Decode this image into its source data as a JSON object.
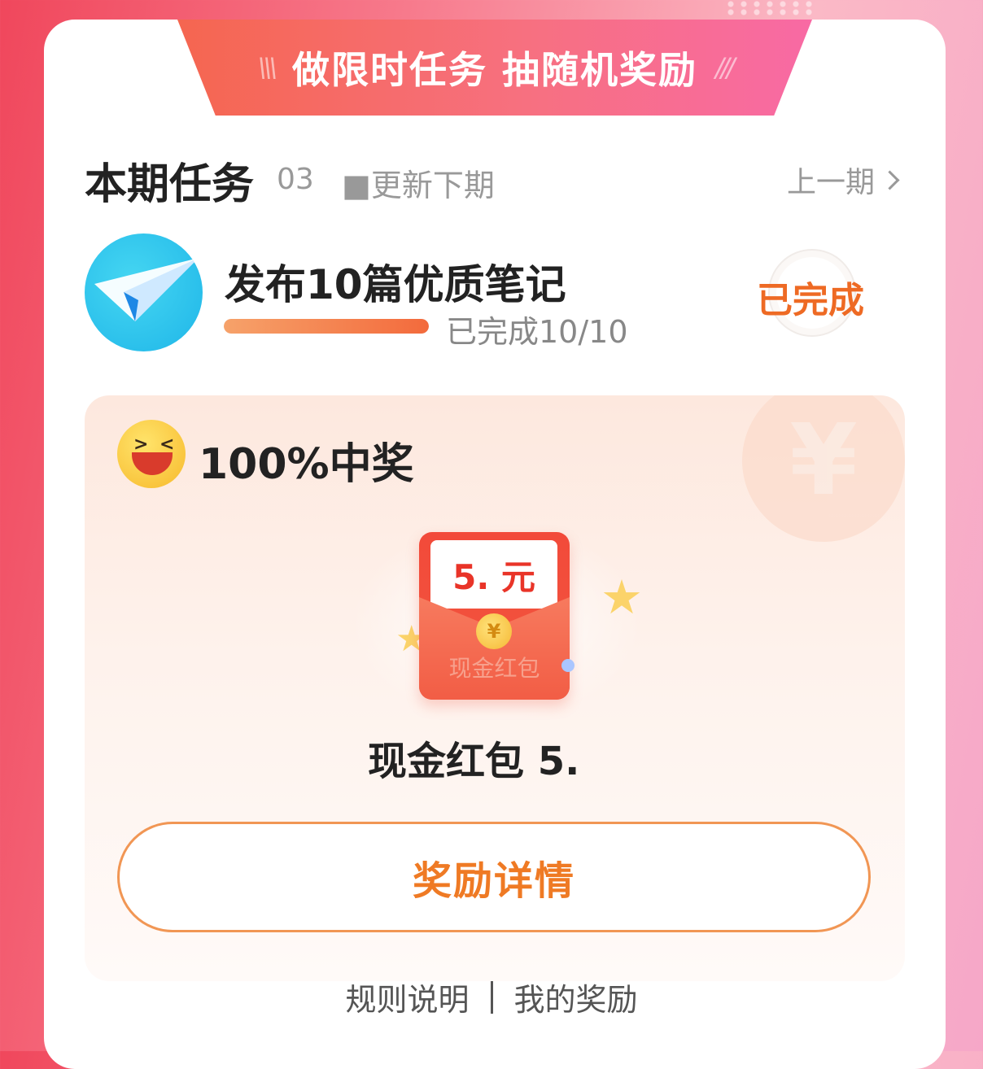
{
  "banner": {
    "title": "做限时任务 抽随机奖励",
    "deco": "\\\\\\"
  },
  "period": {
    "title": "本期任务",
    "number": "03",
    "update": "■更新下期",
    "prev": "上一期"
  },
  "task": {
    "name": "发布10篇优质笔记",
    "progress_text": "已完成10/10",
    "progress_fraction": 1.0,
    "status": "已完成"
  },
  "reward": {
    "win_rate": "100%中奖",
    "amount_label": "5.  元",
    "packet_label": "现金红包",
    "prize_name": "现金红包 5."
  },
  "actions": {
    "detail_button": "奖励详情"
  },
  "footer": {
    "rules": "规则说明",
    "my_rewards": "我的奖励"
  },
  "colors": {
    "accent": "#ef7a24",
    "banner_start": "#f56650",
    "banner_end": "#f86aa4"
  }
}
